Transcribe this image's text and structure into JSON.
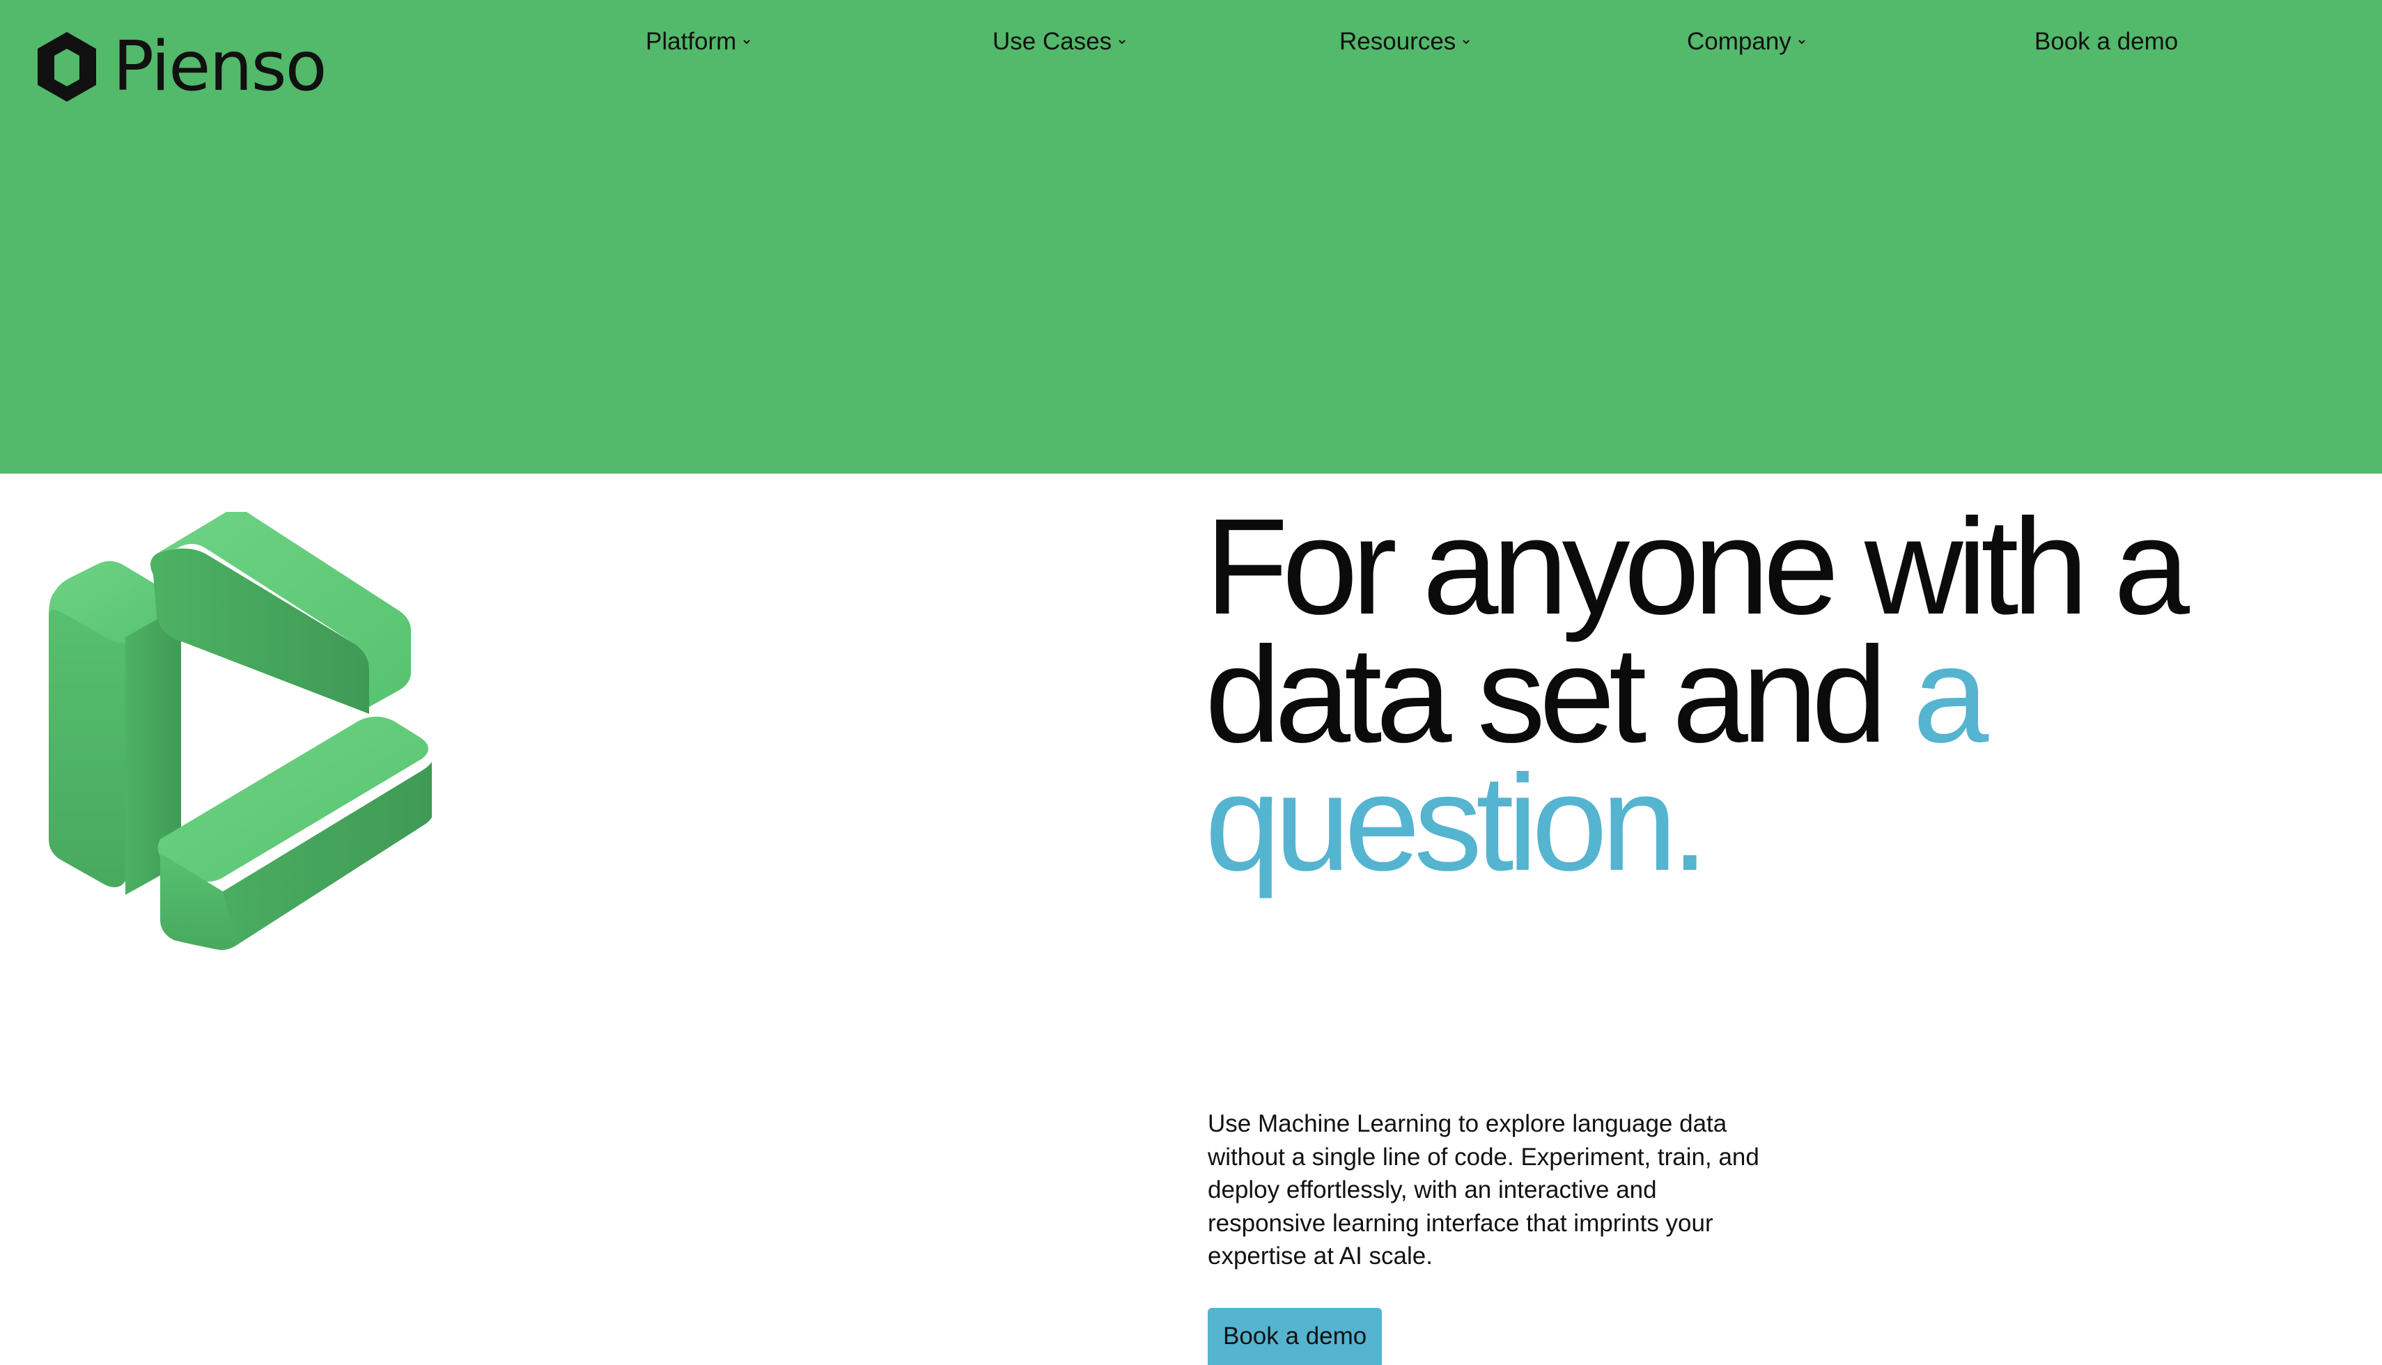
{
  "brand": {
    "name": "Pienso",
    "accent_green": "#53b96b",
    "accent_blue": "#55b4d0"
  },
  "nav": {
    "items": [
      {
        "label": "Platform",
        "has_dropdown": true,
        "icon": "chevron-down-icon"
      },
      {
        "label": "Use Cases",
        "has_dropdown": true,
        "icon": "chevron-down-icon"
      },
      {
        "label": "Resources",
        "has_dropdown": true,
        "icon": "chevron-down-icon"
      },
      {
        "label": "Company",
        "has_dropdown": true,
        "icon": "chevron-down-icon"
      }
    ],
    "cta_label": "Book a demo"
  },
  "hero": {
    "headline_part1": "For anyone with a data set and",
    "headline_accent": "a question.",
    "lead": "Use Machine Learning to explore language data without a single line of code. Experiment, train, and deploy effortlessly, with an interactive and responsive learning interface that imprints your expertise at AI scale.",
    "cta_label": "Book a demo",
    "illustration": "3d-green-play-logo"
  }
}
